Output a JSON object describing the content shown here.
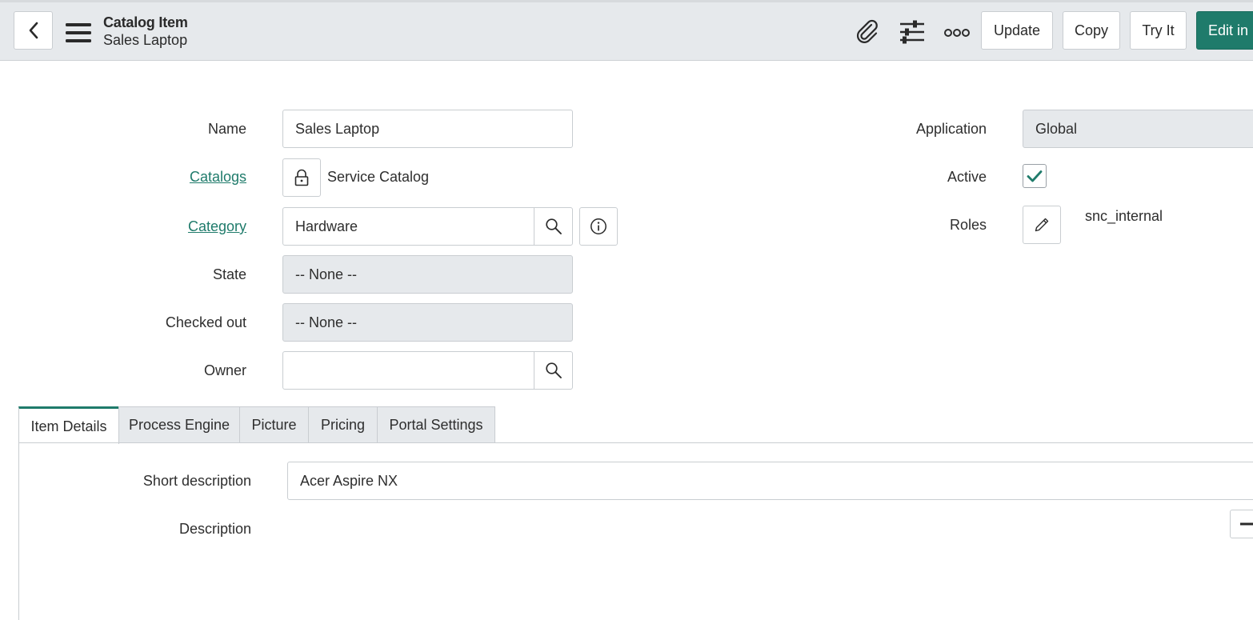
{
  "header": {
    "title": "Catalog Item",
    "subtitle": "Sales Laptop",
    "icons": [
      "back-chevron-icon",
      "hamburger-menu-icon",
      "paperclip-icon",
      "sliders-icon",
      "more-options-icon"
    ],
    "buttons": {
      "update": "Update",
      "copy": "Copy",
      "try_it": "Try It",
      "edit_in": "Edit in"
    },
    "accent_color": "#1f7b6b"
  },
  "form": {
    "name": {
      "label": "Name",
      "value": "Sales Laptop"
    },
    "catalogs": {
      "label": "Catalogs",
      "value": "Service Catalog",
      "icon": "lock-icon"
    },
    "category": {
      "label": "Category",
      "value": "Hardware",
      "icons": [
        "search-icon",
        "info-icon"
      ]
    },
    "state": {
      "label": "State",
      "value": "-- None --"
    },
    "checked_out": {
      "label": "Checked out",
      "value": "-- None --"
    },
    "owner": {
      "label": "Owner",
      "value": "",
      "icon": "search-icon"
    },
    "application": {
      "label": "Application",
      "value": "Global"
    },
    "active": {
      "label": "Active",
      "checked": true
    },
    "roles": {
      "label": "Roles",
      "value": "snc_internal",
      "icon": "pencil-icon"
    }
  },
  "tabs": [
    {
      "label": "Item Details",
      "active": true
    },
    {
      "label": "Process Engine",
      "active": false
    },
    {
      "label": "Picture",
      "active": false
    },
    {
      "label": "Pricing",
      "active": false
    },
    {
      "label": "Portal Settings",
      "active": false
    }
  ],
  "item_details": {
    "short_description": {
      "label": "Short description",
      "value": "Acer Aspire NX"
    },
    "description": {
      "label": "Description"
    }
  }
}
